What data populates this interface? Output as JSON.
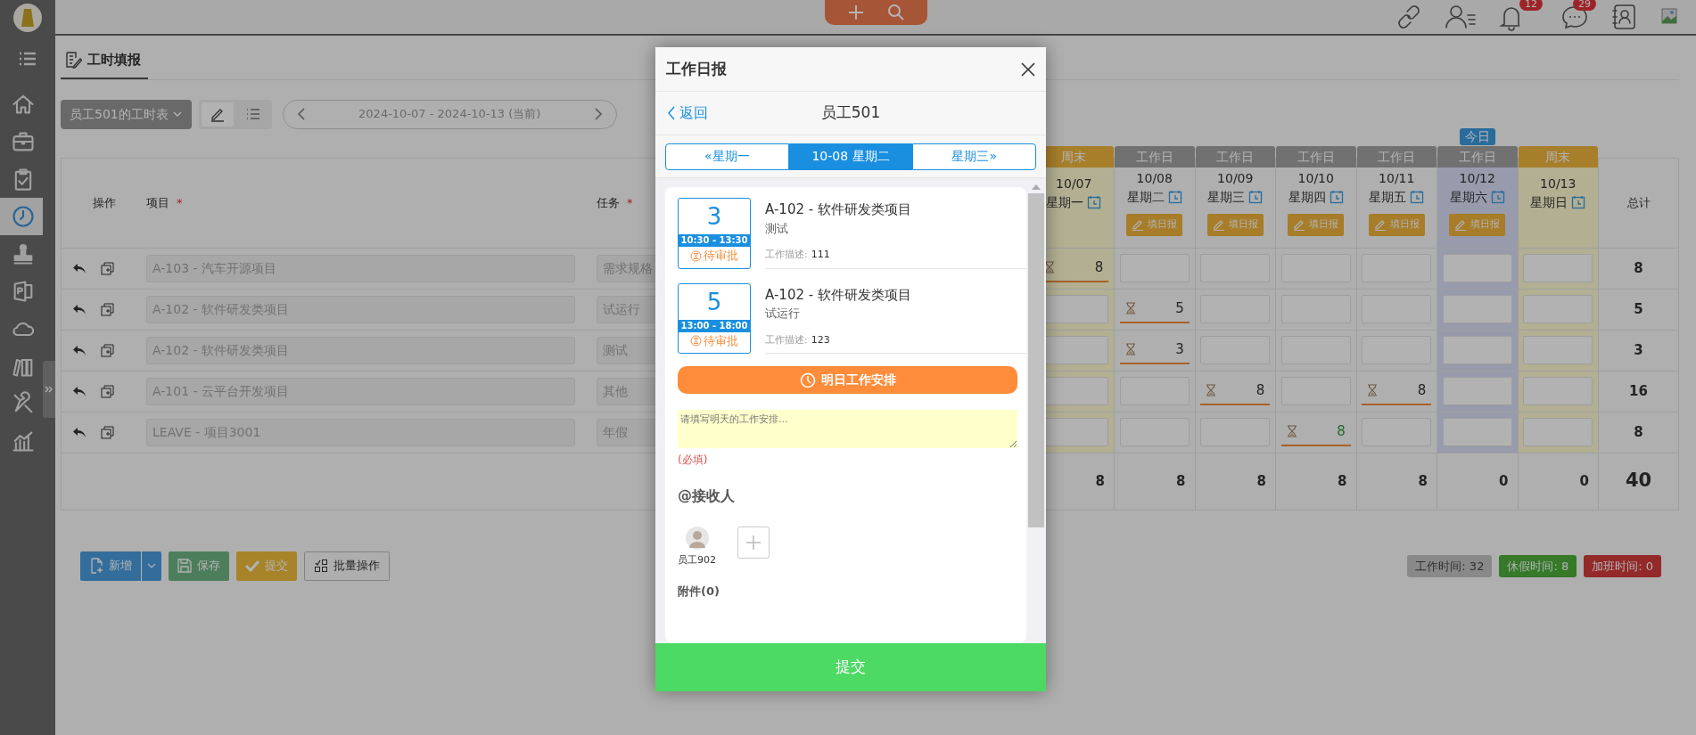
{
  "topbar": {
    "notifications": "12",
    "messages": "29"
  },
  "sidebar": {
    "items": [
      {
        "selected": false
      },
      {
        "selected": false
      },
      {
        "selected": false
      },
      {
        "selected": true
      },
      {
        "selected": false
      },
      {
        "selected": false
      },
      {
        "selected": false
      },
      {
        "selected": false
      },
      {
        "selected": false
      },
      {
        "selected": false
      }
    ]
  },
  "page_tab": {
    "title": "工时填报"
  },
  "toolbar": {
    "timesheet_button": "员工501的工时表",
    "view_modes": [
      {
        "selected": true
      },
      {
        "selected": false
      }
    ],
    "date_range": "2024-10-07 - 2024-10-13 (当前)"
  },
  "table": {
    "columns": [
      {
        "label": "操作"
      },
      {
        "label": "项目",
        "required_mark": "*"
      },
      {
        "label": "任务",
        "required_mark": "*"
      }
    ],
    "today_label": "今日",
    "days": [
      {
        "tag": "周末",
        "kind": "weekend",
        "date": "10/07",
        "weekday": "星期一",
        "today": false
      },
      {
        "tag": "工作日",
        "kind": "workday",
        "date": "10/08",
        "weekday": "星期二",
        "today": false,
        "fill_button": "填日报"
      },
      {
        "tag": "工作日",
        "kind": "workday",
        "date": "10/09",
        "weekday": "星期三",
        "today": false,
        "fill_button": "填日报"
      },
      {
        "tag": "工作日",
        "kind": "workday",
        "date": "10/10",
        "weekday": "星期四",
        "today": false,
        "fill_button": "填日报"
      },
      {
        "tag": "工作日",
        "kind": "workday",
        "date": "10/11",
        "weekday": "星期五",
        "today": false,
        "fill_button": "填日报"
      },
      {
        "tag": "工作日",
        "kind": "workday",
        "date": "10/12",
        "weekday": "星期六",
        "today": true,
        "fill_button": "填日报"
      },
      {
        "tag": "周末",
        "kind": "weekend",
        "date": "10/13",
        "weekday": "星期日",
        "today": false
      }
    ],
    "total_label": "总计",
    "rows": [
      {
        "project": "A-103 - 汽车开源项目",
        "task": "需求规格",
        "hours": [
          {
            "filled": true,
            "value": "8",
            "kind": "work",
            "pending": true
          },
          {
            "filled": false
          },
          {
            "filled": false
          },
          {
            "filled": false
          },
          {
            "filled": false
          },
          {
            "filled": false
          },
          {
            "filled": false
          }
        ],
        "total": "8"
      },
      {
        "project": "A-102 - 软件研发类项目",
        "task": "试运行",
        "hours": [
          {
            "filled": false
          },
          {
            "filled": true,
            "value": "5",
            "kind": "work",
            "pending": true
          },
          {
            "filled": false
          },
          {
            "filled": false
          },
          {
            "filled": false
          },
          {
            "filled": false
          },
          {
            "filled": false
          }
        ],
        "total": "5"
      },
      {
        "project": "A-102 - 软件研发类项目",
        "task": "测试",
        "hours": [
          {
            "filled": false
          },
          {
            "filled": true,
            "value": "3",
            "kind": "work",
            "pending": true
          },
          {
            "filled": false
          },
          {
            "filled": false
          },
          {
            "filled": false
          },
          {
            "filled": false
          },
          {
            "filled": false
          }
        ],
        "total": "3"
      },
      {
        "project": "A-101 - 云平台开发项目",
        "task": "其他",
        "hours": [
          {
            "filled": false
          },
          {
            "filled": false
          },
          {
            "filled": true,
            "value": "8",
            "kind": "work",
            "pending": true
          },
          {
            "filled": false
          },
          {
            "filled": true,
            "value": "8",
            "kind": "work",
            "pending": true
          },
          {
            "filled": false
          },
          {
            "filled": false
          }
        ],
        "total": "16"
      },
      {
        "project": "LEAVE - 项目3001",
        "task": "年假",
        "hours": [
          {
            "filled": false
          },
          {
            "filled": false
          },
          {
            "filled": false
          },
          {
            "filled": true,
            "value": "8",
            "kind": "leave",
            "pending": true
          },
          {
            "filled": false
          },
          {
            "filled": false
          },
          {
            "filled": false
          }
        ],
        "total": "8"
      }
    ],
    "day_totals": [
      "8",
      "8",
      "8",
      "8",
      "8",
      "0",
      "0"
    ],
    "grand_total": "40"
  },
  "actions": {
    "add": "新增",
    "save": "保存",
    "submit": "提交",
    "batch": "批量操作"
  },
  "summary": [
    {
      "label": "工作时间: 32",
      "kind": "work"
    },
    {
      "label": "休假时间: 8",
      "kind": "leave"
    },
    {
      "label": "加班时间: 0",
      "kind": "overtime"
    }
  ],
  "dialog": {
    "title": "工作日报",
    "back": "返回",
    "employee": "员工501",
    "days": [
      {
        "label": "«星期一",
        "selected": false
      },
      {
        "label": "10-08 星期二",
        "selected": true
      },
      {
        "label": "星期三»",
        "selected": false
      }
    ],
    "entries": [
      {
        "hours": "3",
        "time": "10:30 - 13:30",
        "status": "待审批",
        "project": "A-102 - 软件研发类项目",
        "task": "测试",
        "description_label": "工作描述:",
        "description": "111"
      },
      {
        "hours": "5",
        "time": "13:00 - 18:00",
        "status": "待审批",
        "project": "A-102 - 软件研发类项目",
        "task": "试运行",
        "description_label": "工作描述:",
        "description": "123"
      }
    ],
    "plan_button": "明日工作安排",
    "plan_placeholder": "请填写明天的工作安排...",
    "required_note": "(必填)",
    "recipients_title": "@接收人",
    "recipients": [
      {
        "name": "员工902"
      }
    ],
    "attachments": "附件(0)",
    "submit": "提交"
  }
}
